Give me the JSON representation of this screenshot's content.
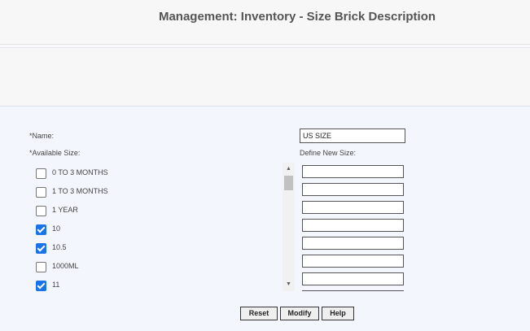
{
  "header": {
    "title": "Management: Inventory - Size Brick Description"
  },
  "form": {
    "name_label": "*Name:",
    "name_value": "US SIZE",
    "available_label": "*Available Size:",
    "define_label": "Define New Size:",
    "sizes": [
      {
        "label": "0 TO 3 MONTHS",
        "checked": false
      },
      {
        "label": "1 TO 3 MONTHS",
        "checked": false
      },
      {
        "label": "1 YEAR",
        "checked": false
      },
      {
        "label": "10",
        "checked": true
      },
      {
        "label": "10.5",
        "checked": true
      },
      {
        "label": "1000ML",
        "checked": false
      },
      {
        "label": "11",
        "checked": true
      }
    ]
  },
  "buttons": {
    "reset": "Reset",
    "modify": "Modify",
    "help": "Help"
  },
  "colors": {
    "checkbox_checked": "#1a73e8",
    "form_background": "#f3f6fc"
  }
}
